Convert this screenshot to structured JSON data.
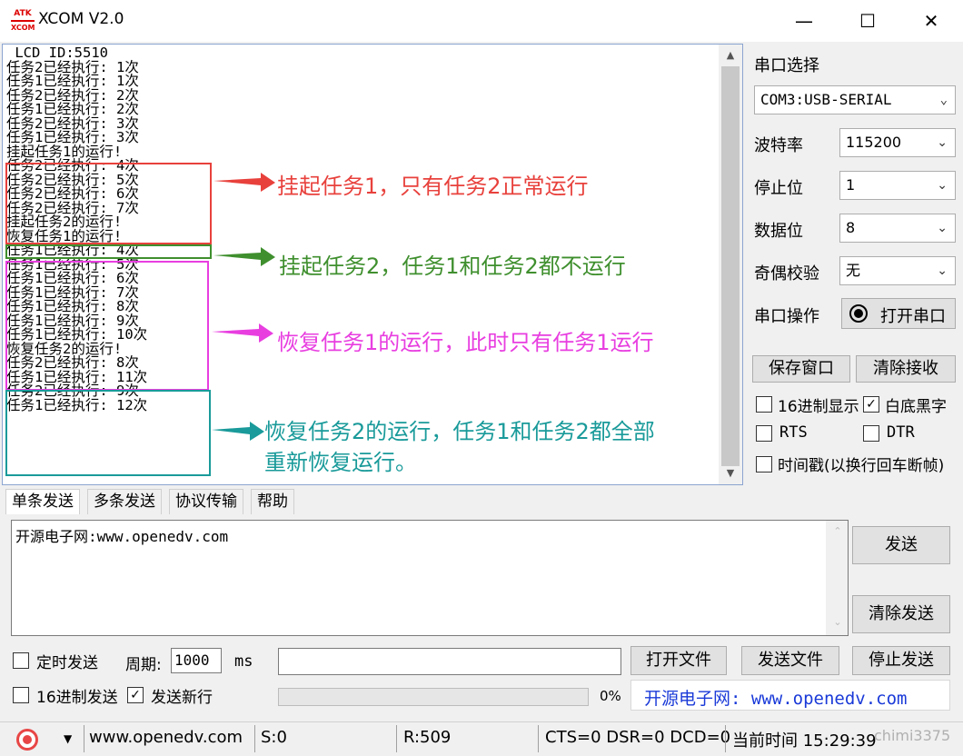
{
  "window": {
    "title": "XCOM V2.0",
    "logo_top": "ATK",
    "logo_bottom": "XCOM"
  },
  "receive": {
    "lines": [
      " LCD ID:5510",
      "任务2已经执行: 1次",
      "任务1已经执行: 1次",
      "任务2已经执行: 2次",
      "任务1已经执行: 2次",
      "任务2已经执行: 3次",
      "任务1已经执行: 3次",
      "挂起任务1的运行!",
      "任务2已经执行: 4次",
      "任务2已经执行: 5次",
      "任务2已经执行: 6次",
      "任务2已经执行: 7次",
      "挂起任务2的运行!",
      "恢复任务1的运行!",
      "任务1已经执行: 4次",
      "任务1已经执行: 5次",
      "任务1已经执行: 6次",
      "任务1已经执行: 7次",
      "任务1已经执行: 8次",
      "任务1已经执行: 9次",
      "任务1已经执行: 10次",
      "恢复任务2的运行!",
      "任务2已经执行: 8次",
      "任务1已经执行: 11次",
      "任务2已经执行: 9次",
      "任务1已经执行: 12次"
    ]
  },
  "annotations": {
    "a1": "挂起任务1，只有任务2正常运行",
    "a2": "挂起任务2，任务1和任务2都不运行",
    "a3": "恢复任务1的运行，此时只有任务1运行",
    "a4_line1": "恢复任务2的运行，任务1和任务2都全部",
    "a4_line2": "重新恢复运行。",
    "colors": {
      "red": "#e8413c",
      "green": "#3f8f2e",
      "magenta": "#e83ee0",
      "teal": "#1a9a9a"
    }
  },
  "serial": {
    "port_label": "串口选择",
    "port_value": "COM3:USB-SERIAL",
    "baud_label": "波特率",
    "baud_value": "115200",
    "stop_label": "停止位",
    "stop_value": "1",
    "data_label": "数据位",
    "data_value": "8",
    "parity_label": "奇偶校验",
    "parity_value": "无",
    "op_label": "串口操作",
    "open_button": "打开串口",
    "save_button": "保存窗口",
    "clear_recv_button": "清除接收",
    "hex_display": "16进制显示",
    "white_black": "白底黑字",
    "rts": "RTS",
    "dtr": "DTR",
    "timestamp": "时间戳(以换行回车断帧)"
  },
  "tabs": [
    "单条发送",
    "多条发送",
    "协议传输",
    "帮助"
  ],
  "send": {
    "text": "开源电子网:www.openedv.com",
    "send_button": "发送",
    "clear_send_button": "清除发送",
    "timed_send": "定时发送",
    "period_label": "周期:",
    "period_value": "1000",
    "period_unit": "ms",
    "open_file": "打开文件",
    "send_file": "发送文件",
    "stop_send": "停止发送",
    "hex_send": "16进制发送",
    "send_newline": "发送新行",
    "progress": "0%",
    "progress_value": 0,
    "banner": "开源电子网: www.openedv.com"
  },
  "status": {
    "site": "www.openedv.com",
    "s": "S:0",
    "r": "R:509",
    "lines": "CTS=0 DSR=0 DCD=0",
    "time": "当前时间 15:29:39",
    "watermark": "chimi3375"
  }
}
